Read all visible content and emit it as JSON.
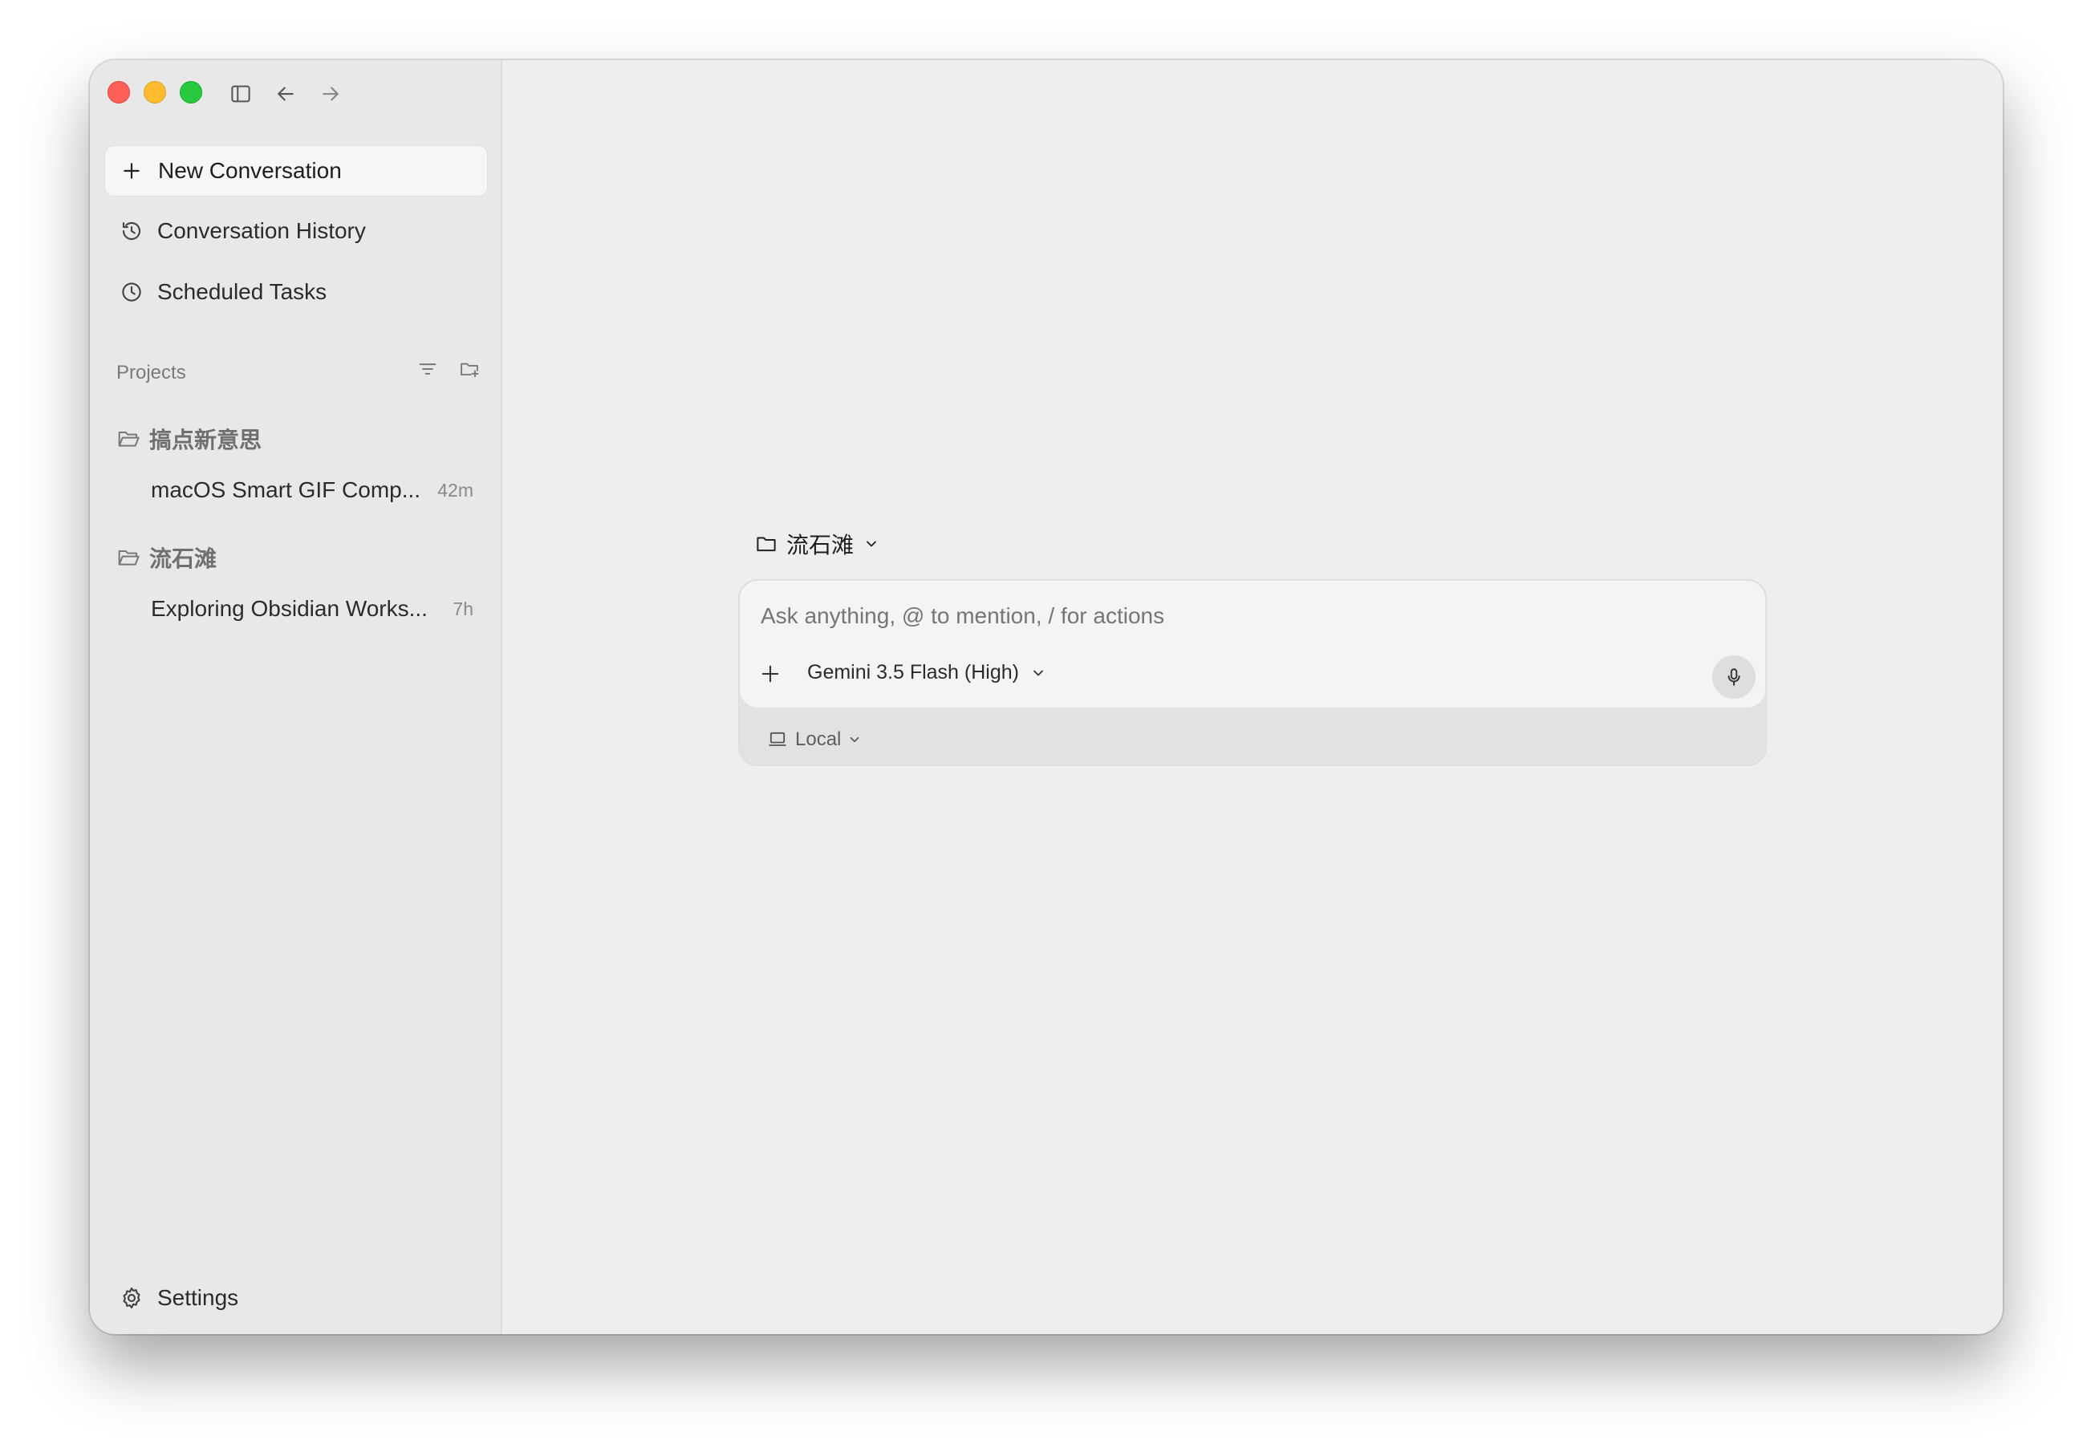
{
  "titlebar": {
    "icons": [
      "sidebar-toggle-icon",
      "arrow-left-icon",
      "arrow-right-icon"
    ]
  },
  "sidebar": {
    "new_conversation": "New Conversation",
    "conversation_history": "Conversation History",
    "scheduled_tasks": "Scheduled Tasks",
    "projects_label": "Projects",
    "projects": [
      {
        "name": "搞点新意思",
        "conversations": [
          {
            "title": "macOS Smart GIF Comp...",
            "time": "42m"
          }
        ]
      },
      {
        "name": "流石滩",
        "conversations": [
          {
            "title": "Exploring Obsidian Works...",
            "time": "7h"
          }
        ]
      }
    ],
    "settings": "Settings"
  },
  "main": {
    "workspace": "流石滩",
    "composer": {
      "placeholder": "Ask anything, @ to mention, / for actions",
      "model": "Gemini 3.5 Flash (High)",
      "environment": "Local"
    }
  },
  "colors": {
    "close": "#ff5f57",
    "minimize": "#febc2e",
    "maximize": "#28c840",
    "sidebar_bg": "#e8e8e8",
    "main_bg": "#eeeeee"
  }
}
